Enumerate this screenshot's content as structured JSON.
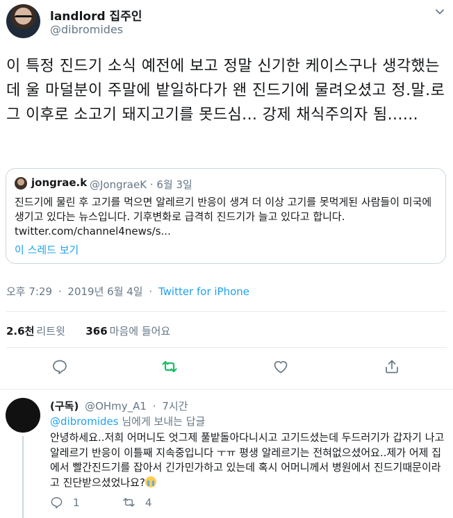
{
  "tweet": {
    "author_name": "landlord 집주인",
    "author_handle": "@dibromides",
    "text": "이 특정 진드기 소식 예전에 보고 정말 신기한 케이스구나 생각했는데 울 마덜분이 주말에 밭일하다가 왠 진드기에 물려오셨고 정.말.로 그 이후로 소고기 돼지고기를 못드심... 강제 채식주의자 됨......",
    "quote": {
      "name": "jongrae.k",
      "handle": "@JongraeK",
      "dot": "·",
      "date": "6월 3일",
      "text": "진드기에 물린 후 고기를 먹으면 알레르기 반응이 생겨 더 이상 고기를 못먹게된 사람들이 미국에 생기고 있다는 뉴스입니다. 기후변화로 급격히 진드기가 늘고 있다고 합니다. twitter.com/channel4news/s...",
      "thread_link": "이 스레드 보기"
    },
    "time": "오후 7:29",
    "dot": "·",
    "date": "2019년 6월 4일",
    "source": "Twitter for iPhone",
    "retweet_count": "2.6천",
    "retweet_label": "리트윗",
    "like_count": "366",
    "like_label": "마음에 들어요"
  },
  "reply": {
    "name": "(구독)",
    "handle": "@OHmy_A1",
    "dot": "·",
    "time": "7시간",
    "replying_mention": "@dibromides",
    "replying_suffix": "님에게 보내는 답글",
    "text": "안녕하세요..저희 어머니도 엇그제 풀밭돌아다니시고 고기드셨는데 두드러기가 갑자기 나고 알레르기 반응이 이틀째 지속중입니다 ㅜㅠ 평생 알레르기는 전혀없으셨어요..제가 어제 집에서 빨간진드기를 잡아서 긴가민가하고 있는데 혹시 어머니께서 병원에서 진드기때문이라고 진단받으셨었나요?",
    "reply_count": "1",
    "retweet_count": "4"
  },
  "colors": {
    "accent": "#1da1f2",
    "retweet_green": "#17bf63",
    "secondary_text": "#657786",
    "border": "#e6ecf0"
  },
  "icons": [
    "chevron-down-icon",
    "reply-icon",
    "retweet-icon",
    "heart-icon",
    "share-icon",
    "crying-face-emoji"
  ]
}
